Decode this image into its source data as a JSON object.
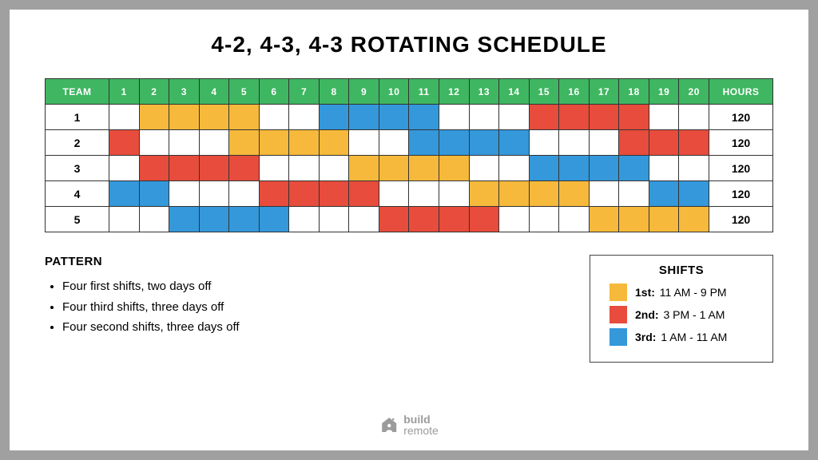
{
  "title": "4-2, 4-3, 4-3 ROTATING SCHEDULE",
  "columns": {
    "team": "TEAM",
    "days": [
      "1",
      "2",
      "3",
      "4",
      "5",
      "6",
      "7",
      "8",
      "9",
      "10",
      "11",
      "12",
      "13",
      "14",
      "15",
      "16",
      "17",
      "18",
      "19",
      "20"
    ],
    "hours": "HOURS"
  },
  "shift_colors": {
    "1": "#f6b93b",
    "2": "#e74c3c",
    "3": "#3498db",
    "off": "#ffffff"
  },
  "teams": [
    {
      "name": "1",
      "hours": "120",
      "days": [
        "off",
        "1",
        "1",
        "1",
        "1",
        "off",
        "off",
        "3",
        "3",
        "3",
        "3",
        "off",
        "off",
        "off",
        "2",
        "2",
        "2",
        "2",
        "off",
        "off"
      ]
    },
    {
      "name": "2",
      "hours": "120",
      "days": [
        "2",
        "off",
        "off",
        "off",
        "1",
        "1",
        "1",
        "1",
        "off",
        "off",
        "3",
        "3",
        "3",
        "3",
        "off",
        "off",
        "off",
        "2",
        "2",
        "2"
      ]
    },
    {
      "name": "3",
      "hours": "120",
      "days": [
        "off",
        "2",
        "2",
        "2",
        "2",
        "off",
        "off",
        "off",
        "1",
        "1",
        "1",
        "1",
        "off",
        "off",
        "3",
        "3",
        "3",
        "3",
        "off",
        "off"
      ]
    },
    {
      "name": "4",
      "hours": "120",
      "days": [
        "3",
        "3",
        "off",
        "off",
        "off",
        "2",
        "2",
        "2",
        "2",
        "off",
        "off",
        "off",
        "1",
        "1",
        "1",
        "1",
        "off",
        "off",
        "3",
        "3"
      ]
    },
    {
      "name": "5",
      "hours": "120",
      "days": [
        "off",
        "off",
        "3",
        "3",
        "3",
        "3",
        "off",
        "off",
        "off",
        "2",
        "2",
        "2",
        "2",
        "off",
        "off",
        "off",
        "1",
        "1",
        "1",
        "1"
      ]
    }
  ],
  "pattern": {
    "title": "PATTERN",
    "items": [
      "Four first shifts, two days off",
      "Four third shifts, three days off",
      "Four second shifts, three days off"
    ]
  },
  "legend": {
    "title": "SHIFTS",
    "items": [
      {
        "swatch": "1",
        "label_bold": "1st:",
        "label_rest": "  11 AM - 9 PM"
      },
      {
        "swatch": "2",
        "label_bold": "2nd:",
        "label_rest": " 3 PM - 1 AM"
      },
      {
        "swatch": "3",
        "label_bold": "3rd:",
        "label_rest": " 1 AM - 11 AM"
      }
    ]
  },
  "brand": {
    "line1": "build",
    "line2": "remote"
  }
}
